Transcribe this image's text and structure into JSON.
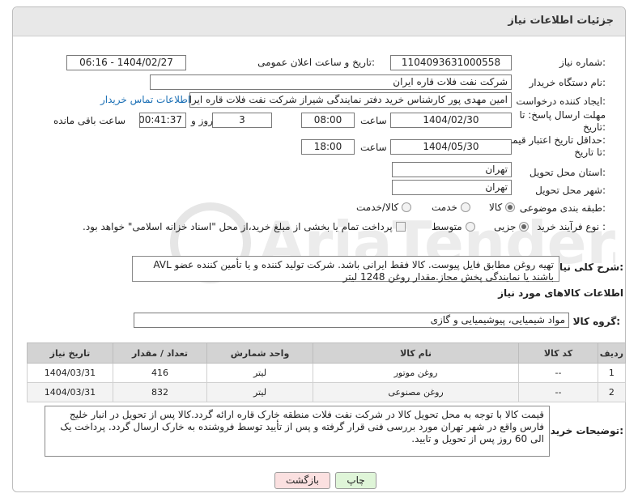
{
  "header": {
    "title": "جزئیات اطلاعات نیاز"
  },
  "form": {
    "need_number": {
      "label": "شماره نیاز:",
      "value": "1104093631000558"
    },
    "announce_datetime": {
      "label": "تاریخ و ساعت اعلان عمومی:",
      "value": "1404/02/27 - 06:16"
    },
    "buyer_org": {
      "label": "نام دستگاه خریدار:",
      "value": "شرکت نفت فلات قاره ایران"
    },
    "requester": {
      "label": "ایجاد کننده درخواست:",
      "value": "امین مهدی پور کارشناس خرید دفتر نمایندگی شیراز شرکت نفت فلات قاره ایران",
      "contact_link": "اطلاعات تماس خریدار"
    },
    "send_deadline": {
      "label_line1": "مهلت ارسال پاسخ: تا",
      "label_line2": "تاریخ:",
      "date": "1404/02/30",
      "time_label": "ساعت",
      "time": "08:00",
      "days": "3",
      "days_label": "روز و",
      "remaining": "00:41:37",
      "remaining_label": "ساعت باقی مانده"
    },
    "price_validity": {
      "label_line1": "حداقل تاریخ اعتبار قیمت:",
      "label_line2": "تا تاریخ:",
      "date": "1404/05/30",
      "time_label": "ساعت",
      "time": "18:00"
    },
    "province": {
      "label": "استان محل تحویل:",
      "value": "تهران"
    },
    "city": {
      "label": "شهر محل تحویل:",
      "value": "تهران"
    },
    "category": {
      "label": "طبقه بندی موضوعی:",
      "options": [
        "کالا",
        "خدمت",
        "کالا/خدمت"
      ],
      "selected": "کالا"
    },
    "process_type": {
      "label": "نوع فرآیند خرید :",
      "options": [
        "جزیی",
        "متوسط"
      ],
      "selected": "جزیی",
      "payment_note": "پرداخت تمام یا بخشی از مبلغ خرید،از محل \"اسناد خزانه اسلامی\" خواهد بود."
    },
    "description": {
      "label": "شرح کلی نیاز:",
      "value": "تهیه روغن مطابق فایل پیوست. کالا فقط ایرانی باشد. شرکت تولید کننده و یا تأمین کننده عضو AVL باشند یا نمایندگی پخش مجاز.مقدار روغن 1248 لیتر"
    }
  },
  "goods_section": {
    "title": "اطلاعات کالاهای مورد نیاز",
    "group_label": "گروه کالا:",
    "group_value": "مواد شیمیایی، پیوشیمیایی و  گازی"
  },
  "table": {
    "headers": [
      "ردیف",
      "کد کالا",
      "نام کالا",
      "واحد شمارش",
      "تعداد / مقدار",
      "تاریخ نیاز"
    ],
    "rows": [
      {
        "index": "1",
        "code": "--",
        "name": "روغن موتور",
        "unit": "لیتر",
        "qty": "416",
        "date": "1404/03/31"
      },
      {
        "index": "2",
        "code": "--",
        "name": "روغن مصنوعی",
        "unit": "لیتر",
        "qty": "832",
        "date": "1404/03/31"
      }
    ]
  },
  "buyer_notes": {
    "label": "توضیحات خریدار:",
    "value": "قیمت کالا با توجه به محل تحویل کالا در شرکت نفت فلات منطقه خارک قاره ارائه گردد.کالا پس از تحویل در انبار خلیج فارس واقع در شهر تهران مورد بررسی فنی قرار گرفته و پس از تأیید توسط فروشنده به خارک ارسال گردد. پرداخت یک الی 60 روز پس از تحویل و تایید."
  },
  "buttons": {
    "print": "چاپ",
    "back": "بازگشت"
  },
  "colors": {
    "header_bg": "#e8e8e8",
    "table_header_bg": "#d3d3d3",
    "print_btn": "#dff5d8",
    "back_btn": "#fbe0e0",
    "link": "#1a6fb5"
  }
}
